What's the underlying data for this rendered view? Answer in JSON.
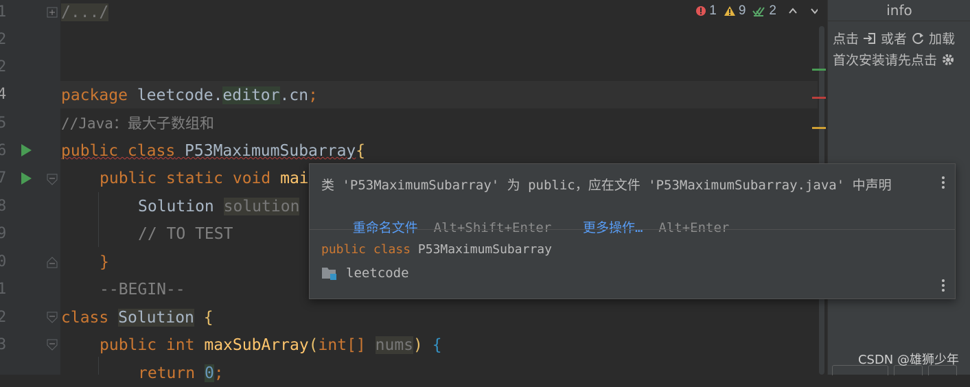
{
  "gutter": {
    "line_numbers": [
      "1",
      "2",
      "3",
      "4",
      "5",
      "6",
      "7",
      "8",
      "9",
      "0",
      "1",
      "2",
      "3"
    ]
  },
  "code": {
    "line1": "/.../",
    "line4_kw": "package",
    "line4_a": "leetcode.",
    "line4_b": "editor",
    "line4_c": ".cn",
    "line4_semi": ";",
    "line5": "//Java：最大子数组和",
    "line6_kw": "public class",
    "line6_name": "P53MaximumSubarray",
    "line6_brace": "{",
    "line7_kw": "public static void",
    "line7_name": "mai",
    "line8_type": "Solution",
    "line8_var": "solution",
    "line9": "// TO TEST",
    "line10": "}",
    "line11": "--BEGIN--",
    "line12_kw": "class",
    "line12_name": "Solution",
    "line12_brace": "{",
    "line13_kw": "public int",
    "line13_method": "maxSubArray",
    "line13_paren": "(",
    "line13_type": "int[]",
    "line13_param": "nums",
    "line13_close": ")",
    "line13_brace": "{",
    "line14_kw": "return",
    "line14_num": "0",
    "line14_semi": ";"
  },
  "status": {
    "errors": "1",
    "warnings": "9",
    "checks": "2",
    "error_color": "#e05555",
    "warning_color": "#e3b341",
    "check_color": "#59a869"
  },
  "popup": {
    "message": "类 'P53MaximumSubarray' 为 public，应在文件 'P53MaximumSubarray.java' 中声明",
    "action1": "重命名文件",
    "action1_shortcut": "Alt+Shift+Enter",
    "action2": "更多操作…",
    "action2_shortcut": "Alt+Enter",
    "decl_kw": "public class",
    "decl_name": "P53MaximumSubarray",
    "package": "leetcode"
  },
  "sidepanel": {
    "title": "info",
    "row1_a": "点击",
    "row1_b": "或者",
    "row1_c": "加载",
    "row2": "首次安装请先点击"
  },
  "watermark": "CSDN @雄狮少年"
}
